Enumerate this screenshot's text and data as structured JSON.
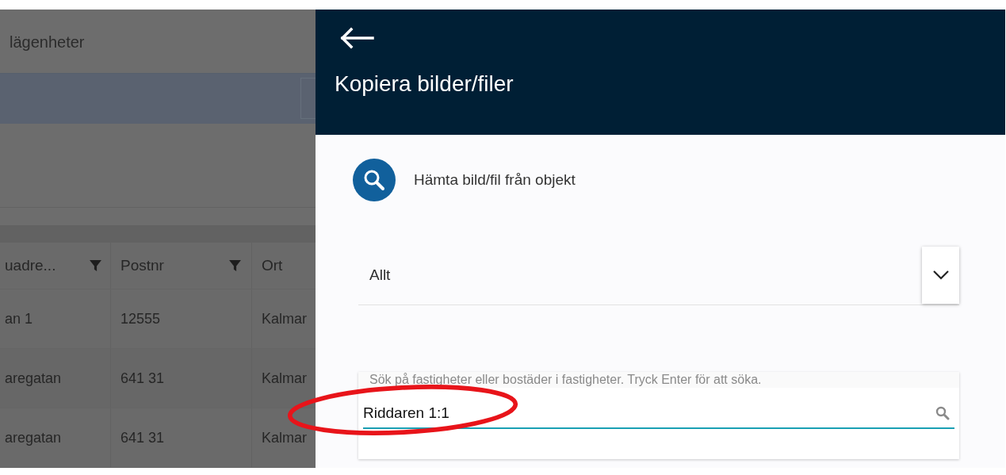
{
  "background_page": {
    "title": "lägenheter",
    "table": {
      "columns": [
        {
          "label": "uadre...",
          "filter": true
        },
        {
          "label": "Postnr",
          "filter": true
        },
        {
          "label": "Ort",
          "filter": false
        }
      ],
      "rows": [
        [
          "an 1",
          "12555",
          "Kalmar"
        ],
        [
          "aregatan",
          "641 31",
          "Kalmar"
        ],
        [
          "aregatan",
          "641 31",
          "Kalmar"
        ]
      ]
    }
  },
  "panel": {
    "title": "Kopiera bilder/filer",
    "action": "Hämta bild/fil från objekt",
    "select": {
      "value": "Allt"
    },
    "search": {
      "label": "Sök på fastigheter eller bostäder i fastigheter. Tryck Enter för att söka.",
      "value": "Riddaren 1:1",
      "focused": true
    }
  }
}
